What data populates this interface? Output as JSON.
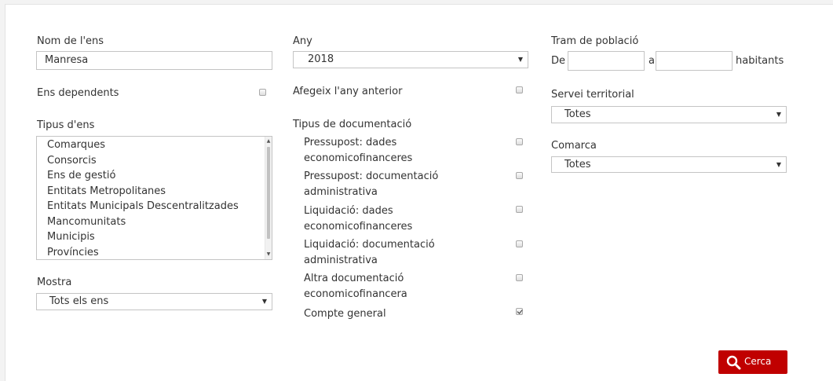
{
  "form": {
    "nom_ens": {
      "label": "Nom de l'ens",
      "value": "Manresa"
    },
    "ens_dependents": {
      "label": "Ens dependents",
      "checked": false
    },
    "tipus_ens": {
      "label": "Tipus d'ens",
      "options": [
        "Comarques",
        "Consorcis",
        "Ens de gestió",
        "Entitats Metropolitanes",
        "Entitats Municipals Descentralitzades",
        "Mancomunitats",
        "Municipis",
        "Províncies"
      ]
    },
    "mostra": {
      "label": "Mostra",
      "value": "Tots els ens"
    },
    "any": {
      "label": "Any",
      "value": "2018"
    },
    "afegeix": {
      "label": "Afegeix l'any anterior",
      "checked": false
    },
    "tipus_documentacio": {
      "label": "Tipus de documentació",
      "items": [
        {
          "line1": "Pressupost: dades",
          "line2": "economicofinanceres",
          "checked": false
        },
        {
          "line1": "Pressupost: documentació",
          "line2": "administrativa",
          "checked": false
        },
        {
          "line1": "Liquidació: dades",
          "line2": "economicofinanceres",
          "checked": false
        },
        {
          "line1": "Liquidació: documentació",
          "line2": "administrativa",
          "checked": false
        },
        {
          "line1": "Altra documentació",
          "line2": "economicofinancera",
          "checked": false
        },
        {
          "line1": "Compte general",
          "line2": "",
          "checked": true
        }
      ]
    },
    "tram": {
      "label": "Tram de població",
      "de_label": "De",
      "a_label": "a",
      "habitants_label": "habitants",
      "from_value": "",
      "to_value": ""
    },
    "servei": {
      "label": "Servei territorial",
      "value": "Totes"
    },
    "comarca": {
      "label": "Comarca",
      "value": "Totes"
    },
    "search_button": {
      "label": "Cerca",
      "icon": "search-icon",
      "color": "#c00000"
    }
  }
}
